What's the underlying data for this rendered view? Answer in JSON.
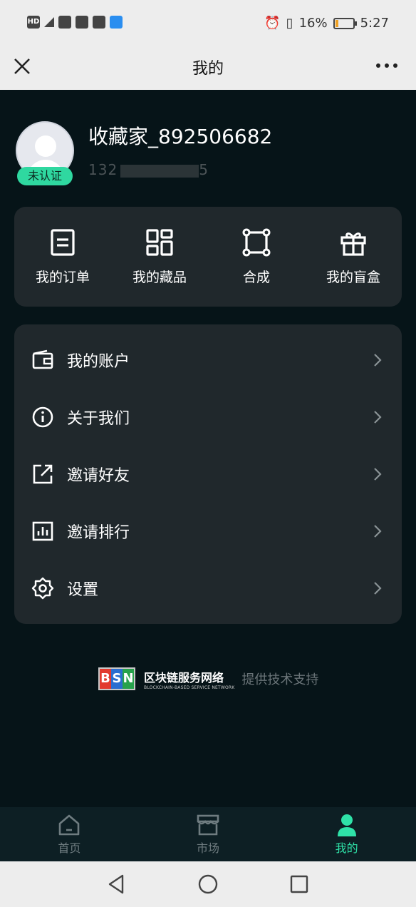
{
  "status_bar": {
    "battery_text": "16%",
    "battery_level": 0.16,
    "time": "5:27",
    "left_icons": [
      "hd-icon",
      "4g-signal-icon",
      "heart-icon",
      "app-icon",
      "wechat-icon",
      "search-app-icon"
    ],
    "right_icons": [
      "alarm-icon",
      "vibrate-icon",
      "battery-icon"
    ]
  },
  "header": {
    "title": "我的",
    "close_icon": "close-icon",
    "more_icon": "more-icon"
  },
  "profile": {
    "username": "收藏家_892506682",
    "phone_visible": "132",
    "phone_tail": "5",
    "badge": "未认证"
  },
  "quick_actions": [
    {
      "label": "我的订单",
      "icon": "order-icon"
    },
    {
      "label": "我的藏品",
      "icon": "collection-icon"
    },
    {
      "label": "合成",
      "icon": "compose-icon"
    },
    {
      "label": "我的盲盒",
      "icon": "gift-icon"
    }
  ],
  "menu": [
    {
      "label": "我的账户",
      "icon": "wallet-icon"
    },
    {
      "label": "关于我们",
      "icon": "info-icon"
    },
    {
      "label": "邀请好友",
      "icon": "share-icon"
    },
    {
      "label": "邀请排行",
      "icon": "chart-icon"
    },
    {
      "label": "设置",
      "icon": "settings-icon"
    }
  ],
  "footer": {
    "bsn_logo": "BSN",
    "bsn_cn": "区块链服务网络",
    "bsn_en": "BLOCKCHAIN-BASED SERVICE NETWORK",
    "support": "提供技术支持"
  },
  "tabbar": [
    {
      "label": "首页",
      "icon": "home-icon",
      "active": false
    },
    {
      "label": "市场",
      "icon": "market-icon",
      "active": false
    },
    {
      "label": "我的",
      "icon": "profile-icon",
      "active": true
    }
  ],
  "colors": {
    "accent": "#2fe2a8",
    "background": "#061418",
    "card": "#20282c",
    "badge": "#2fd8a0"
  }
}
